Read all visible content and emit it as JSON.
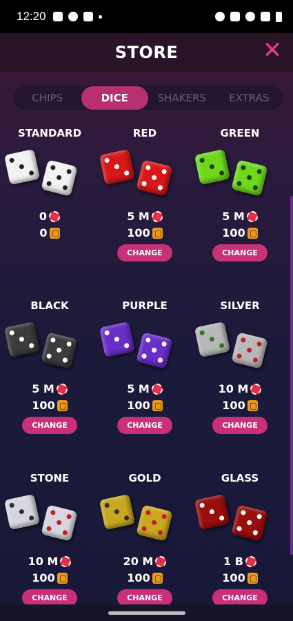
{
  "status_bar": {
    "time": "12:20",
    "icons": [
      "image-icon",
      "face-icon",
      "wrench-icon",
      "dot-icon"
    ],
    "right_icons": [
      "robot-icon",
      "mute-icon",
      "wifi-icon",
      "signal-icon",
      "battery-icon"
    ]
  },
  "header": {
    "title": "STORE",
    "close_icon": "close-icon",
    "close_color": "#e0408c"
  },
  "tabs": [
    {
      "label": "CHIPS",
      "active": false
    },
    {
      "label": "DICE",
      "active": true
    },
    {
      "label": "SHAKERS",
      "active": false
    },
    {
      "label": "EXTRAS",
      "active": false
    }
  ],
  "colors": {
    "accent": "#c83078",
    "chip": "#e0304a",
    "coin": "#e89a20"
  },
  "dice": [
    {
      "name": "STANDARD",
      "chips": "0",
      "coins": "0",
      "button": "",
      "die_color": "#f2f2f2",
      "pip_color": "#222222",
      "faces": [
        3,
        5
      ]
    },
    {
      "name": "RED",
      "chips": "5 M",
      "coins": "100",
      "button": "CHANGE",
      "die_color": "#d81818",
      "pip_color": "#ffffff",
      "faces": [
        3,
        5
      ]
    },
    {
      "name": "GREEN",
      "chips": "5 M",
      "coins": "100",
      "button": "CHANGE",
      "die_color": "#6ed81c",
      "pip_color": "#1f3a08",
      "faces": [
        3,
        5
      ]
    },
    {
      "name": "BLACK",
      "chips": "5 M",
      "coins": "100",
      "button": "CHANGE",
      "die_color": "#3c3c3c",
      "pip_color": "#ffffff",
      "faces": [
        3,
        5
      ]
    },
    {
      "name": "PURPLE",
      "chips": "5 M",
      "coins": "100",
      "button": "CHANGE",
      "die_color": "#6a2ec8",
      "pip_color": "#ffffff",
      "faces": [
        3,
        5
      ]
    },
    {
      "name": "SILVER",
      "chips": "10 M",
      "coins": "100",
      "button": "CHANGE",
      "die_color": "#b8b8b8",
      "pip_color": "#2a7a20",
      "pip_color_2": "#c02020",
      "faces": [
        3,
        5
      ]
    },
    {
      "name": "STONE",
      "chips": "10 M",
      "coins": "100",
      "button": "CHANGE",
      "die_color": "#d6d6e0",
      "pip_color": "#303030",
      "pip_color_2": "#c02020",
      "faces": [
        3,
        5
      ]
    },
    {
      "name": "GOLD",
      "chips": "20 M",
      "coins": "100",
      "button": "CHANGE",
      "die_color": "#c8a820",
      "pip_color": "#303030",
      "pip_color_2": "#c02020",
      "faces": [
        3,
        5
      ]
    },
    {
      "name": "GLASS",
      "chips": "1 B",
      "coins": "100",
      "button": "CHANGE",
      "die_color": "#9a0e0e",
      "pip_color": "#ffffff",
      "faces": [
        3,
        5
      ]
    }
  ]
}
